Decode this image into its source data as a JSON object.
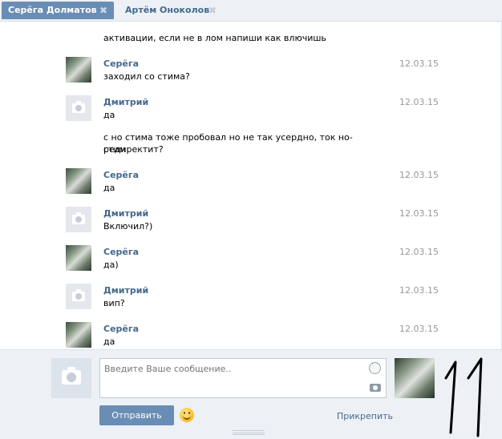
{
  "tabs": [
    {
      "label": "Серёга Долматов",
      "active": true
    },
    {
      "label": "Артём Оноколов",
      "active": false
    }
  ],
  "history": {
    "top_fragment": "активации, если не в лом напиши как влючишь",
    "messages": [
      {
        "author": "Серёга",
        "date": "12.03.15",
        "avatar": "photo",
        "lines": [
          "заходил со стима?"
        ]
      },
      {
        "author": "Дмитрий",
        "date": "12.03.15",
        "avatar": "empty",
        "lines": [
          "да",
          "с но стима тоже пробовал но не так усердно, ток но-стим",
          "редиректит?"
        ]
      },
      {
        "author": "Серёга",
        "date": "12.03.15",
        "avatar": "photo",
        "lines": [
          "да"
        ]
      },
      {
        "author": "Дмитрий",
        "date": "12.03.15",
        "avatar": "empty",
        "lines": [
          "Включил?)"
        ]
      },
      {
        "author": "Серёга",
        "date": "12.03.15",
        "avatar": "photo",
        "lines": [
          "да)"
        ]
      },
      {
        "author": "Дмитрий",
        "date": "12.03.15",
        "avatar": "empty",
        "lines": [
          "вип?"
        ]
      },
      {
        "author": "Серёга",
        "date": "12.03.15",
        "avatar": "photo",
        "lines": [
          "да"
        ]
      }
    ]
  },
  "composer": {
    "placeholder": "Введите Ваше сообщение..",
    "send_label": "Отправить",
    "attach_label": "Прикрепить"
  },
  "icons": {
    "close": "close-icon",
    "camera": "camera-icon",
    "smile": "smile-icon",
    "emoji": "emoji-icon"
  },
  "colors": {
    "accent": "#6a8db6",
    "link": "#45688e",
    "panel": "#edf1f5",
    "date": "#999999"
  }
}
